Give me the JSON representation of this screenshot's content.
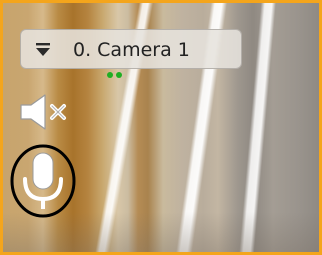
{
  "camera": {
    "title": "0. Camera 1"
  },
  "icons": {
    "menu": "menu-triangle-icon",
    "status": "status-dots-icon",
    "speaker": "speaker-muted-icon",
    "microphone": "microphone-icon"
  },
  "colors": {
    "frame_border": "#f4a51c",
    "status_indicator": "#1fae23",
    "highlight_circle": "#000000"
  }
}
